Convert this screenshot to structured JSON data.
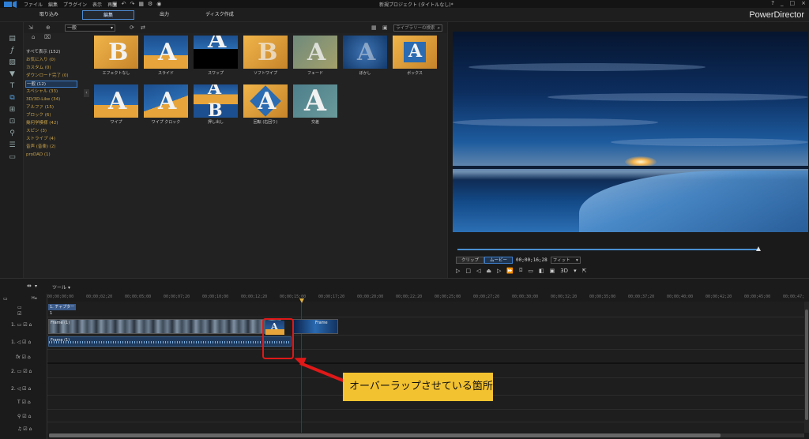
{
  "menubar": {
    "items": [
      "ファイル",
      "編集",
      "プラグイン",
      "表示",
      "再生"
    ],
    "window_title": "新規プロジェクト (タイトルなし)*",
    "window_controls": [
      "?",
      "_",
      "□",
      "×"
    ]
  },
  "modes": {
    "capture": "取り込み",
    "edit": "編集",
    "produce": "出力",
    "disc": "ディスク作成"
  },
  "brand": "PowerDirector",
  "library": {
    "dropdown": "一般",
    "search_placeholder": "ライブラリーの検索",
    "categories": [
      "すべて表示 (152)",
      "お気に入り (0)",
      "カスタム (0)",
      "ダウンロード完了 (0)",
      "一般 (12)",
      "スペシャル (33)",
      "3D/3D-Like (34)",
      "アルファ (15)",
      "ブロック (6)",
      "幾何学模様 (42)",
      "スピン (3)",
      "ストライプ (4)",
      "音声 (音楽) (2)",
      "proDAD (1)"
    ],
    "selected_category": "一般 (12)",
    "transitions": [
      "エフェクトなし",
      "スライド",
      "スワップ",
      "ソフトワイプ",
      "フェード",
      "ぼかし",
      "ボックス",
      "ワイプ",
      "ワイプ クロック",
      "押し出し",
      "回転 (右回り)",
      "交差"
    ]
  },
  "preview": {
    "clip_tab": "クリップ",
    "movie_tab": "ムービー",
    "timecode": "00;00;16;28",
    "fit": "フィット",
    "mode3d": "3D"
  },
  "timeline": {
    "tool_label": "ツール",
    "chapter": "1. チャプター 1",
    "ruler": [
      "00;00;00;00",
      "00;00;02;20",
      "00;00;05;00",
      "00;00;07;20",
      "00;00;10;00",
      "00;00;12;20",
      "00;00;15;00",
      "00;00;17;20",
      "00;00;20;00",
      "00;00;22;20",
      "00;00;25;00",
      "00;00;27;20",
      "00;00;30;00",
      "00;00;32;20",
      "00;00;35;00",
      "00;00;37;20",
      "00;00;40;00",
      "00;00;42;20",
      "00;00;45;00",
      "00;00;47;"
    ],
    "track_labels": {
      "v1": "1.",
      "a1": "1.",
      "fx": "fx",
      "v2": "2.",
      "a2": "2.",
      "title": "T"
    },
    "clip1_name": "Frame (1)",
    "clip2_name": "Frame",
    "audio_name": "Frame (1)"
  },
  "annotation": {
    "callout_text": "オーバーラップさせている箇所",
    "color": "#e01818",
    "callout_bg": "#f3c230"
  },
  "colors": {
    "accent": "#3d7fce",
    "category_text": "#c8a24a",
    "thumb_blue": "#1c4f8f",
    "thumb_orange": "#e7a43a"
  }
}
